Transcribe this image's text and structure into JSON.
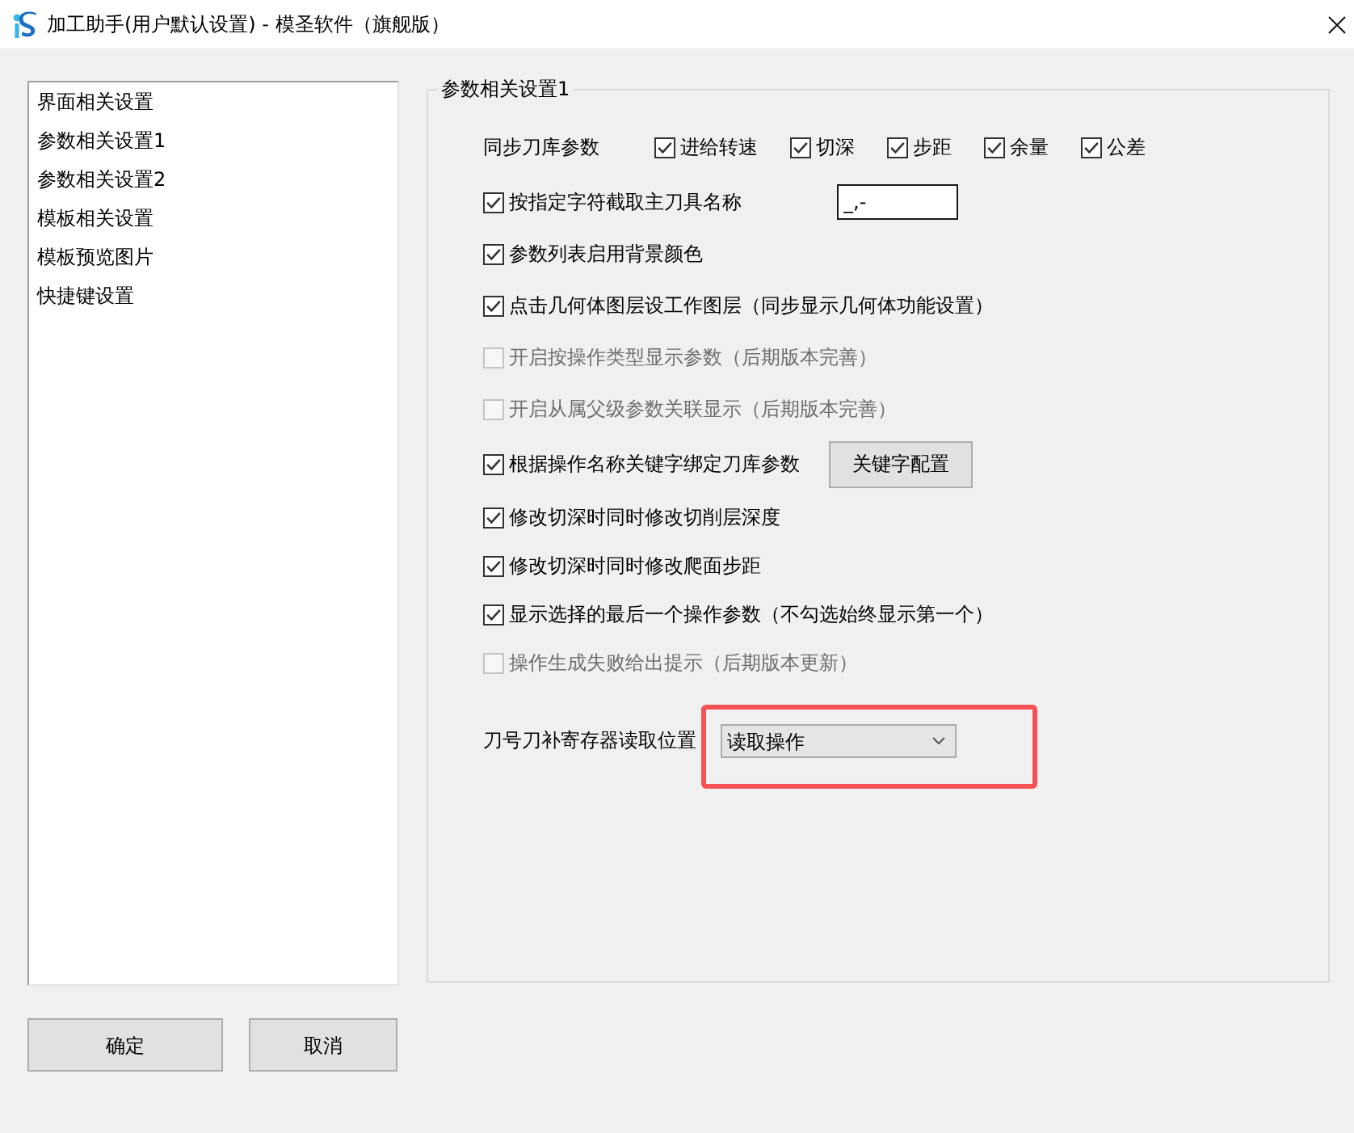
{
  "window": {
    "title": "加工助手(用户默认设置) - 模圣软件（旗舰版）"
  },
  "sidebar": {
    "items": [
      {
        "label": "界面相关设置",
        "selected": false
      },
      {
        "label": "参数相关设置1",
        "selected": false
      },
      {
        "label": "参数相关设置2",
        "selected": false
      },
      {
        "label": "模板相关设置",
        "selected": false
      },
      {
        "label": "模板预览图片",
        "selected": false
      },
      {
        "label": "快捷键设置",
        "selected": false
      }
    ]
  },
  "settings_group": {
    "title": "参数相关设置1",
    "sync_row": {
      "label": "同步刀库参数",
      "options": [
        {
          "label": "进给转速",
          "checked": true
        },
        {
          "label": "切深",
          "checked": true
        },
        {
          "label": "步距",
          "checked": true
        },
        {
          "label": "余量",
          "checked": true
        },
        {
          "label": "公差",
          "checked": true
        }
      ]
    },
    "options": [
      {
        "kind": "field",
        "label": "按指定字符截取主刀具名称",
        "checked": true,
        "disabled": false,
        "value": "_,-"
      },
      {
        "kind": "plain",
        "label": "参数列表启用背景颜色",
        "checked": true,
        "disabled": false
      },
      {
        "kind": "plain",
        "label": "点击几何体图层设工作图层（同步显示几何体功能设置）",
        "checked": true,
        "disabled": false
      },
      {
        "kind": "plain",
        "label": "开启按操作类型显示参数（后期版本完善）",
        "checked": false,
        "disabled": true
      },
      {
        "kind": "plain",
        "label": "开启从属父级参数关联显示（后期版本完善）",
        "checked": false,
        "disabled": true
      },
      {
        "kind": "button",
        "label": "根据操作名称关键字绑定刀库参数",
        "checked": true,
        "disabled": false,
        "button": "关键字配置"
      },
      {
        "kind": "plain",
        "label": "修改切深时同时修改切削层深度",
        "checked": true,
        "disabled": false
      },
      {
        "kind": "plain",
        "label": "修改切深时同时修改爬面步距",
        "checked": true,
        "disabled": false
      },
      {
        "kind": "plain",
        "label": "显示选择的最后一个操作参数（不勾选始终显示第一个）",
        "checked": true,
        "disabled": false
      },
      {
        "kind": "plain",
        "label": "操作生成失败给出提示（后期版本更新）",
        "checked": false,
        "disabled": true
      }
    ],
    "tool_register": {
      "label": "刀号刀补寄存器读取位置",
      "value": "读取操作",
      "highlighted": true
    }
  },
  "buttons": [
    {
      "label": "确定"
    },
    {
      "label": "取消"
    }
  ]
}
